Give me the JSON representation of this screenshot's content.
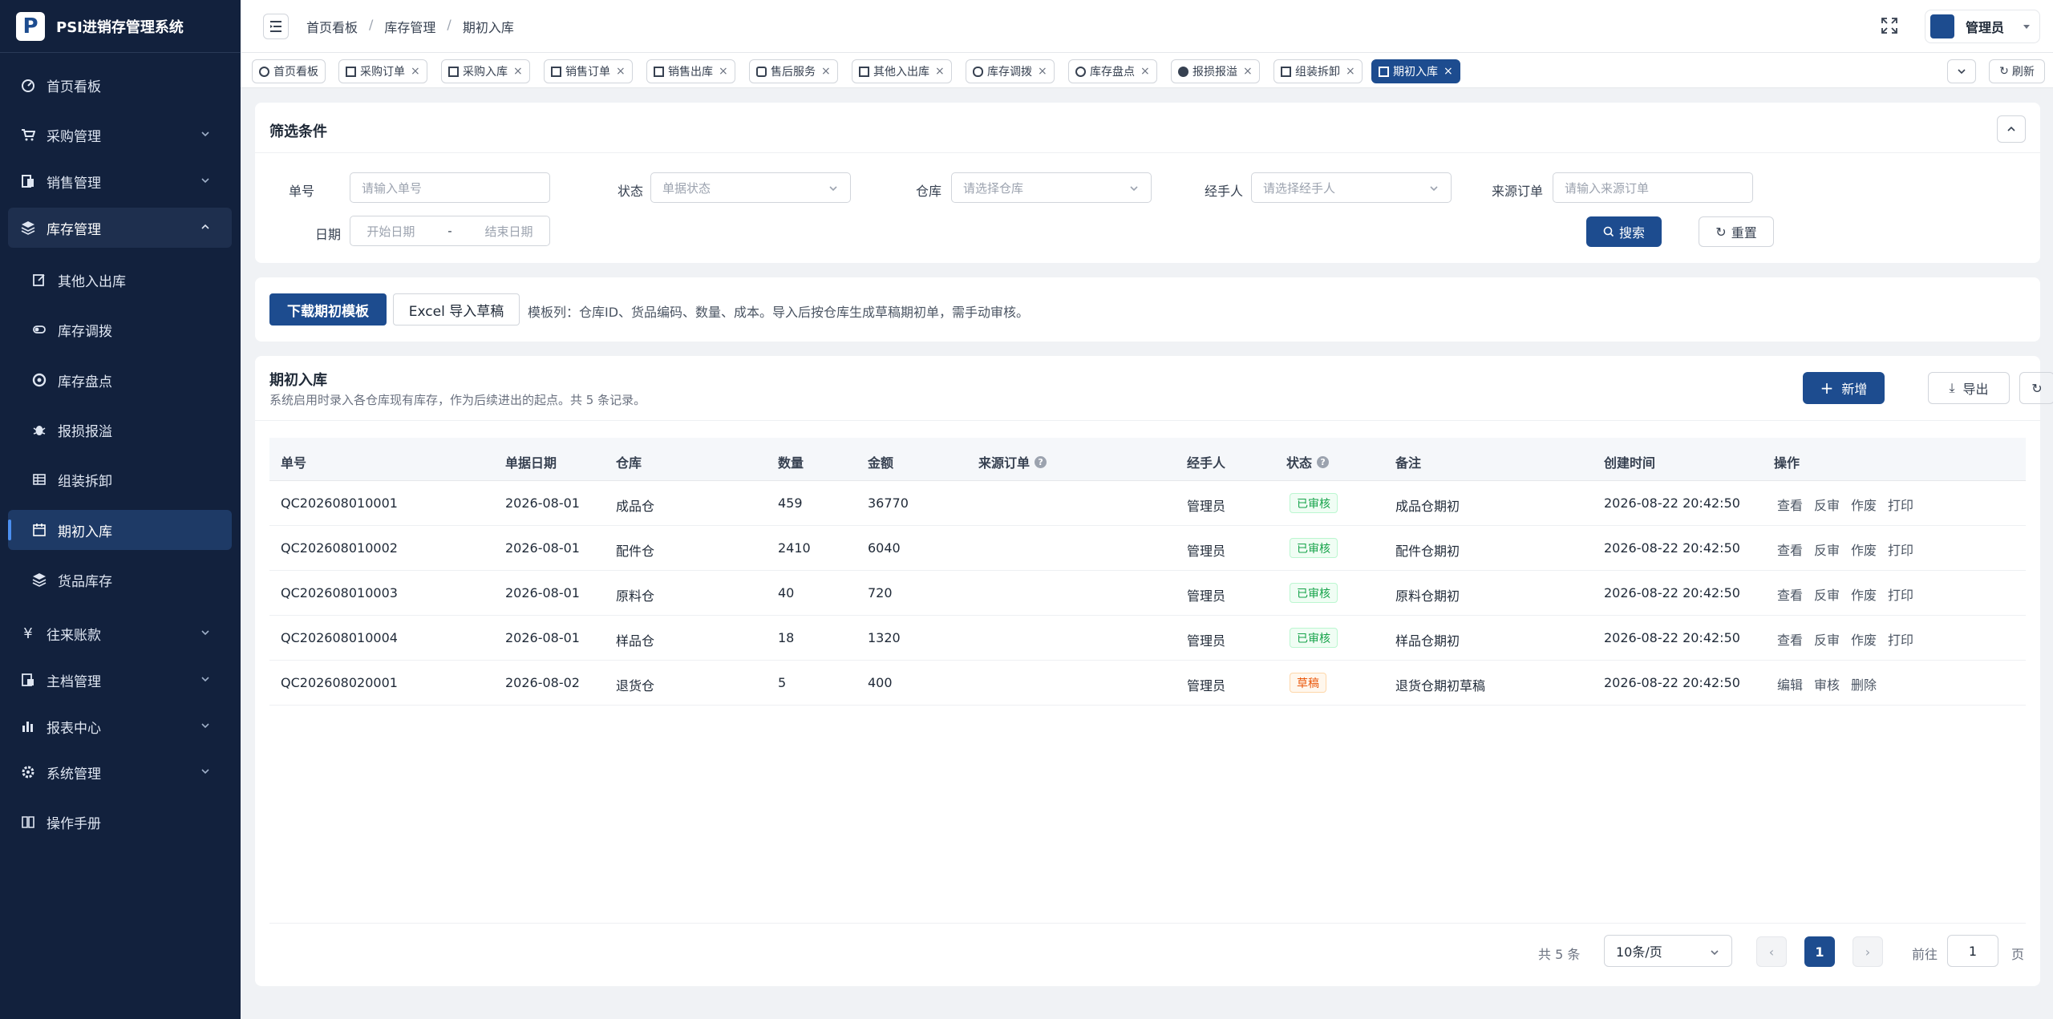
{
  "app": {
    "title": "PSI进销存管理系统",
    "logo_letter": "P"
  },
  "sidebar": {
    "items": [
      {
        "label": "首页看板",
        "icon": "dashboard-icon"
      },
      {
        "label": "采购管理",
        "icon": "cart-icon"
      },
      {
        "label": "销售管理",
        "icon": "sales-icon"
      },
      {
        "label": "库存管理",
        "icon": "box-icon"
      },
      {
        "label": "其他入出库",
        "icon": "edit-icon"
      },
      {
        "label": "库存调拨",
        "icon": "transfer-icon"
      },
      {
        "label": "库存盘点",
        "icon": "check-icon"
      },
      {
        "label": "报损报溢",
        "icon": "bug-icon"
      },
      {
        "label": "组装拆卸",
        "icon": "grid-icon"
      },
      {
        "label": "期初入库",
        "icon": "calendar-icon"
      },
      {
        "label": "货品库存",
        "icon": "stack-icon"
      },
      {
        "label": "往来账款",
        "icon": "yen-icon"
      },
      {
        "label": "主档管理",
        "icon": "archive-icon"
      },
      {
        "label": "报表中心",
        "icon": "chart-icon"
      },
      {
        "label": "系统管理",
        "icon": "gear-icon"
      },
      {
        "label": "操作手册",
        "icon": "book-icon"
      }
    ]
  },
  "header": {
    "breadcrumb": [
      "首页看板",
      "库存管理",
      "期初入库"
    ],
    "user": "管理员"
  },
  "tabs": {
    "items": [
      "首页看板",
      "采购订单",
      "采购入库",
      "销售订单",
      "销售出库",
      "售后服务",
      "其他入出库",
      "库存调拨",
      "库存盘点",
      "报损报溢",
      "组装拆卸",
      "期初入库"
    ],
    "refresh": "刷新"
  },
  "filter": {
    "title": "筛选条件",
    "fields": {
      "order_no": {
        "label": "单号",
        "placeholder": "请输入单号"
      },
      "status": {
        "label": "状态",
        "placeholder": "单据状态"
      },
      "warehouse": {
        "label": "仓库",
        "placeholder": "请选择仓库"
      },
      "handler": {
        "label": "经手人",
        "placeholder": "请选择经手人"
      },
      "source": {
        "label": "来源订单",
        "placeholder": "请输入来源订单"
      },
      "date": {
        "label": "日期",
        "start": "开始日期",
        "sep": "-",
        "end": "结束日期"
      }
    },
    "search": "搜索",
    "reset": "重置"
  },
  "tools": {
    "download": "下载期初模板",
    "import": "Excel 导入草稿",
    "hint": "模板列：仓库ID、货品编码、数量、成本。导入后按仓库生成草稿期初单，需手动审核。"
  },
  "list": {
    "title": "期初入库",
    "subtitle": "系统启用时录入各仓库现有库存，作为后续进出的起点。共 5 条记录。",
    "add": "新增",
    "export": "导出",
    "columns": [
      "单号",
      "单据日期",
      "仓库",
      "数量",
      "金额",
      "来源订单",
      "经手人",
      "状态",
      "备注",
      "创建时间",
      "操作"
    ],
    "rows": [
      {
        "no": "QC202608010001",
        "date": "2026-08-01",
        "wh": "成品仓",
        "qty": "459",
        "amt": "36770",
        "src": "",
        "handler": "管理员",
        "status": "已审核",
        "note": "成品仓期初",
        "created": "2026-08-22 20:42:50",
        "ops": [
          "查看",
          "反审",
          "作废",
          "打印"
        ]
      },
      {
        "no": "QC202608010002",
        "date": "2026-08-01",
        "wh": "配件仓",
        "qty": "2410",
        "amt": "6040",
        "src": "",
        "handler": "管理员",
        "status": "已审核",
        "note": "配件仓期初",
        "created": "2026-08-22 20:42:50",
        "ops": [
          "查看",
          "反审",
          "作废",
          "打印"
        ]
      },
      {
        "no": "QC202608010003",
        "date": "2026-08-01",
        "wh": "原料仓",
        "qty": "40",
        "amt": "720",
        "src": "",
        "handler": "管理员",
        "status": "已审核",
        "note": "原料仓期初",
        "created": "2026-08-22 20:42:50",
        "ops": [
          "查看",
          "反审",
          "作废",
          "打印"
        ]
      },
      {
        "no": "QC202608010004",
        "date": "2026-08-01",
        "wh": "样品仓",
        "qty": "18",
        "amt": "1320",
        "src": "",
        "handler": "管理员",
        "status": "已审核",
        "note": "样品仓期初",
        "created": "2026-08-22 20:42:50",
        "ops": [
          "查看",
          "反审",
          "作废",
          "打印"
        ]
      },
      {
        "no": "QC202608020001",
        "date": "2026-08-02",
        "wh": "退货仓",
        "qty": "5",
        "amt": "400",
        "src": "",
        "handler": "管理员",
        "status": "草稿",
        "note": "退货仓期初草稿",
        "created": "2026-08-22 20:42:50",
        "ops": [
          "编辑",
          "审核",
          "删除"
        ]
      }
    ]
  },
  "pagination": {
    "total": "共 5 条",
    "size": "10条/页",
    "current": "1",
    "goto": "前往",
    "goto_value": "1",
    "page_suffix": "页"
  },
  "colors": {
    "primary": "#1d4c8f",
    "sidebar": "#12213d",
    "approved": "#16a34a",
    "draft": "#ea580c"
  }
}
